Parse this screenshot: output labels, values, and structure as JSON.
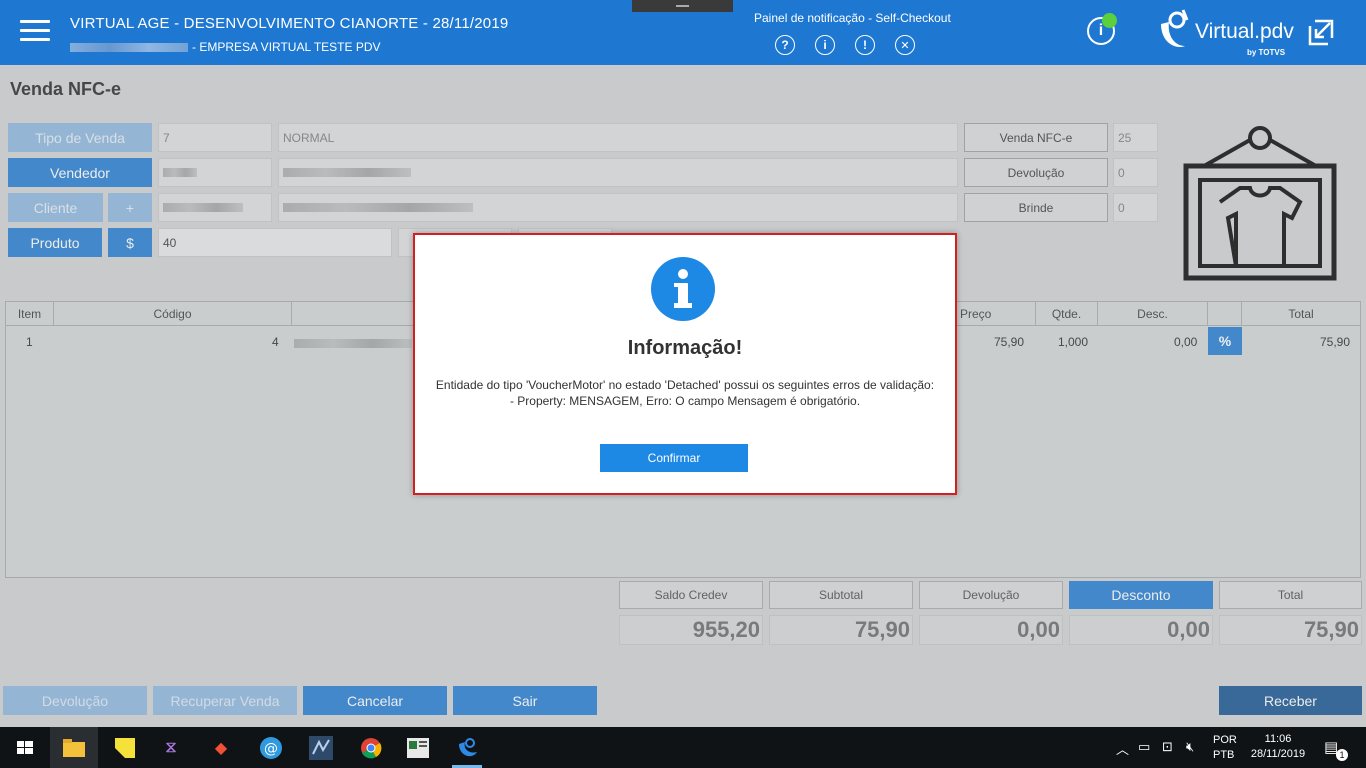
{
  "header": {
    "title": "VIRTUAL AGE - DESENVOLVIMENTO CIANORTE - 28/11/2019",
    "subtitle": "- EMPRESA VIRTUAL TESTE PDV",
    "notification_title": "Painel de notificação - Self-Checkout",
    "notification_icons": [
      "help-icon",
      "info-icon",
      "alert-icon",
      "close-icon"
    ],
    "brand_name": "Virtual.pdv",
    "brand_by": "by TOTVS"
  },
  "page": {
    "title": "Venda NFC-e"
  },
  "form": {
    "tipo_venda_label": "Tipo de Venda",
    "tipo_venda_code": "7",
    "tipo_venda_name": "NORMAL",
    "vendedor_label": "Vendedor",
    "cliente_label": "Cliente",
    "cliente_add": "+",
    "produto_label": "Produto",
    "produto_price_btn": "$",
    "produto_value": "40",
    "venda_nfce_label": "Venda NFC-e",
    "venda_nfce_count": "25",
    "devolucao_label": "Devolução",
    "devolucao_count": "0",
    "brinde_label": "Brinde",
    "brinde_count": "0"
  },
  "table": {
    "headers": [
      "Item",
      "Código",
      "Preço",
      "Qtde.",
      "Desc.",
      "Total"
    ],
    "rows": [
      {
        "item": "1",
        "codigo": "4",
        "preco": "75,90",
        "qtde": "1,000",
        "desc": "0,00",
        "total": "75,90"
      }
    ],
    "discount_icon": "percent-icon"
  },
  "totals": {
    "saldo_credev_label": "Saldo Credev",
    "saldo_credev_value": "955,20",
    "subtotal_label": "Subtotal",
    "subtotal_value": "75,90",
    "devolucao_label": "Devolução",
    "devolucao_value": "0,00",
    "desconto_label": "Desconto",
    "desconto_value": "0,00",
    "total_label": "Total",
    "total_value": "75,90"
  },
  "actions": {
    "devolucao": "Devolução",
    "recuperar_venda": "Recuperar Venda",
    "cancelar": "Cancelar",
    "sair": "Sair",
    "receber": "Receber"
  },
  "modal": {
    "title": "Informação!",
    "message_line1": "Entidade do tipo 'VoucherMotor' no estado 'Detached' possui os seguintes erros de validação:",
    "message_line2": "- Property: MENSAGEM, Erro: O campo Mensagem é obrigatório.",
    "confirm": "Confirmar"
  },
  "taskbar": {
    "lang_top": "POR",
    "lang_bottom": "PTB",
    "time": "11:06",
    "date": "28/11/2019",
    "notification_count": "1"
  },
  "colors": {
    "primary": "#1e78d2",
    "modal_border": "#d31f1f",
    "taskbar": "#101316"
  }
}
